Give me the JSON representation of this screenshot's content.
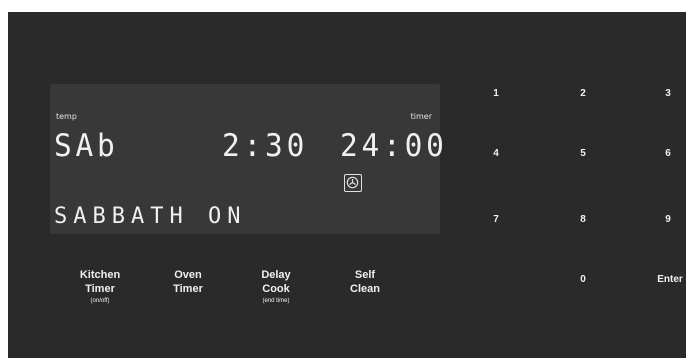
{
  "display": {
    "temp_label": "temp",
    "timer_label": "timer",
    "mode_code": "SAb",
    "clock": "2:30",
    "timer": "24:00",
    "message": "SABBATH ON",
    "oven_icon": "oven-fan-icon"
  },
  "keypad": {
    "keys": [
      "1",
      "2",
      "3",
      "4",
      "5",
      "6",
      "7",
      "8",
      "9",
      "0",
      "Enter"
    ]
  },
  "functions": {
    "kitchen_timer": {
      "line1": "Kitchen",
      "line2": "Timer",
      "sub": "(on/off)"
    },
    "oven_timer": {
      "line1": "Oven",
      "line2": "Timer"
    },
    "delay_cook": {
      "line1": "Delay",
      "line2": "Cook",
      "sub": "(end time)"
    },
    "self_clean": {
      "line1": "Self",
      "line2": "Clean"
    }
  },
  "colors": {
    "panel": "#2a2a2a",
    "display": "#383838",
    "segment": "#f0f0f0"
  }
}
